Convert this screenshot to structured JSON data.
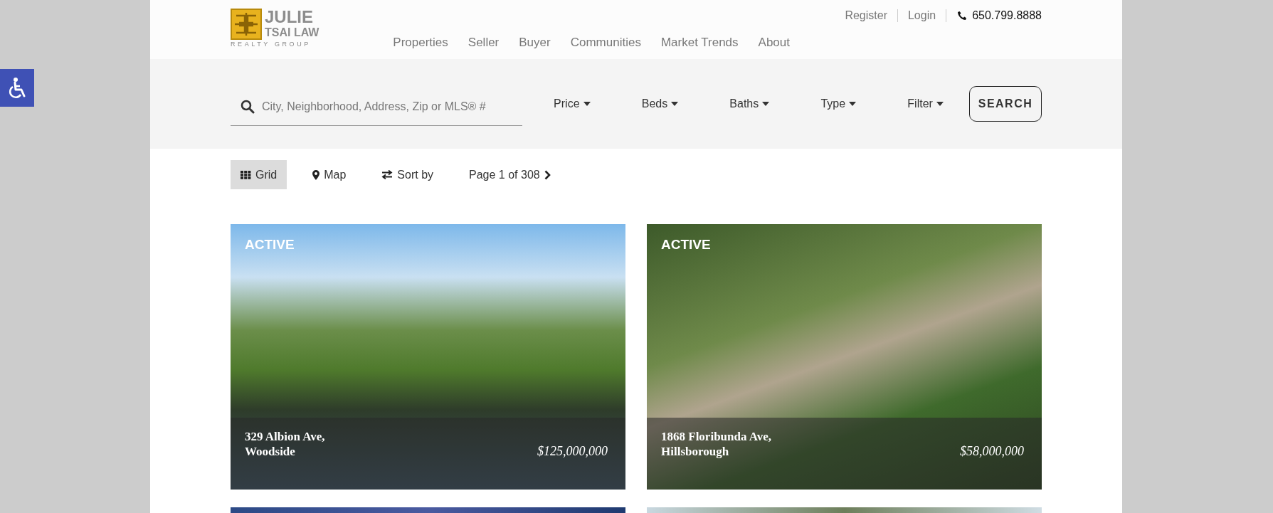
{
  "logo": {
    "line_1": "JULIE",
    "line_2": "TSAI LAW",
    "line_3": "REALTY GROUP"
  },
  "top_links": [
    "Register",
    "Login"
  ],
  "phone": "650.799.8888",
  "nav": [
    "Properties",
    "Seller",
    "Buyer",
    "Communities",
    "Market Trends",
    "About"
  ],
  "search": {
    "placeholder": "City, Neighborhood, Address, Zip or MLS® #",
    "dropdowns": [
      "Price",
      "Beds",
      "Baths",
      "Type",
      "Filter"
    ],
    "button": "SEARCH"
  },
  "toolbar": {
    "views": [
      {
        "label": "Grid",
        "kind": "grid",
        "selected": true
      },
      {
        "label": "Map",
        "kind": "map",
        "selected": false
      }
    ],
    "sort": "Sort by",
    "pagination": "Page 1 of 308"
  },
  "listings": [
    {
      "kind": "full",
      "status": "ACTIVE",
      "address_line_1": "329 Albion Ave,",
      "address_line_2": "Woodside",
      "price": "$125,000,000"
    },
    {
      "kind": "full",
      "status": "ACTIVE",
      "address_line_1": "1868 Floribunda Ave,",
      "address_line_2": "Hillsborough",
      "price": "$58,000,000"
    },
    {
      "kind": "cut"
    },
    {
      "kind": "cut"
    }
  ]
}
